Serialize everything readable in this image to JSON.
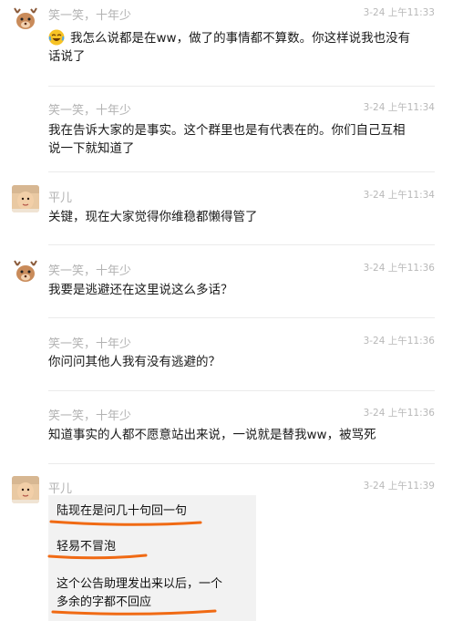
{
  "messages": [
    {
      "sender": "笑一笑，十年少",
      "time": "3-24 上午11:33",
      "text": "我怎么说都是在ww，做了的事情都不算数。你这样说我也没有话说了",
      "emoji": "crying-laughing-emoji"
    },
    {
      "sender": "笑一笑，十年少",
      "time": "3-24 上午11:34",
      "text": "我在告诉大家的是事实。这个群里也是有代表在的。你们自己互相说一下就知道了"
    },
    {
      "sender": "平儿",
      "time": "3-24 上午11:34",
      "text": "关键，现在大家觉得你维稳都懒得管了"
    },
    {
      "sender": "笑一笑，十年少",
      "time": "3-24 上午11:36",
      "text": "我要是逃避还在这里说这么多话？"
    },
    {
      "sender": "笑一笑，十年少",
      "time": "3-24 上午11:36",
      "text": "你问问其他人我有没有逃避的？"
    },
    {
      "sender": "笑一笑，十年少",
      "time": "3-24 上午11:36",
      "text": "知道事实的人都不愿意站出来说，一说就是替我ww，被骂死"
    },
    {
      "sender": "平儿",
      "time": "3-24 上午11:39",
      "quoted_lines": [
        "陆现在是问几十句回一句",
        "轻易不冒泡",
        "这个公告助理发出来以后，一个",
        "多余的字都不回应"
      ]
    }
  ],
  "colors": {
    "underline": "#f06a14",
    "quote_bg": "#f2f2f2",
    "meta": "#b2b2b2"
  }
}
